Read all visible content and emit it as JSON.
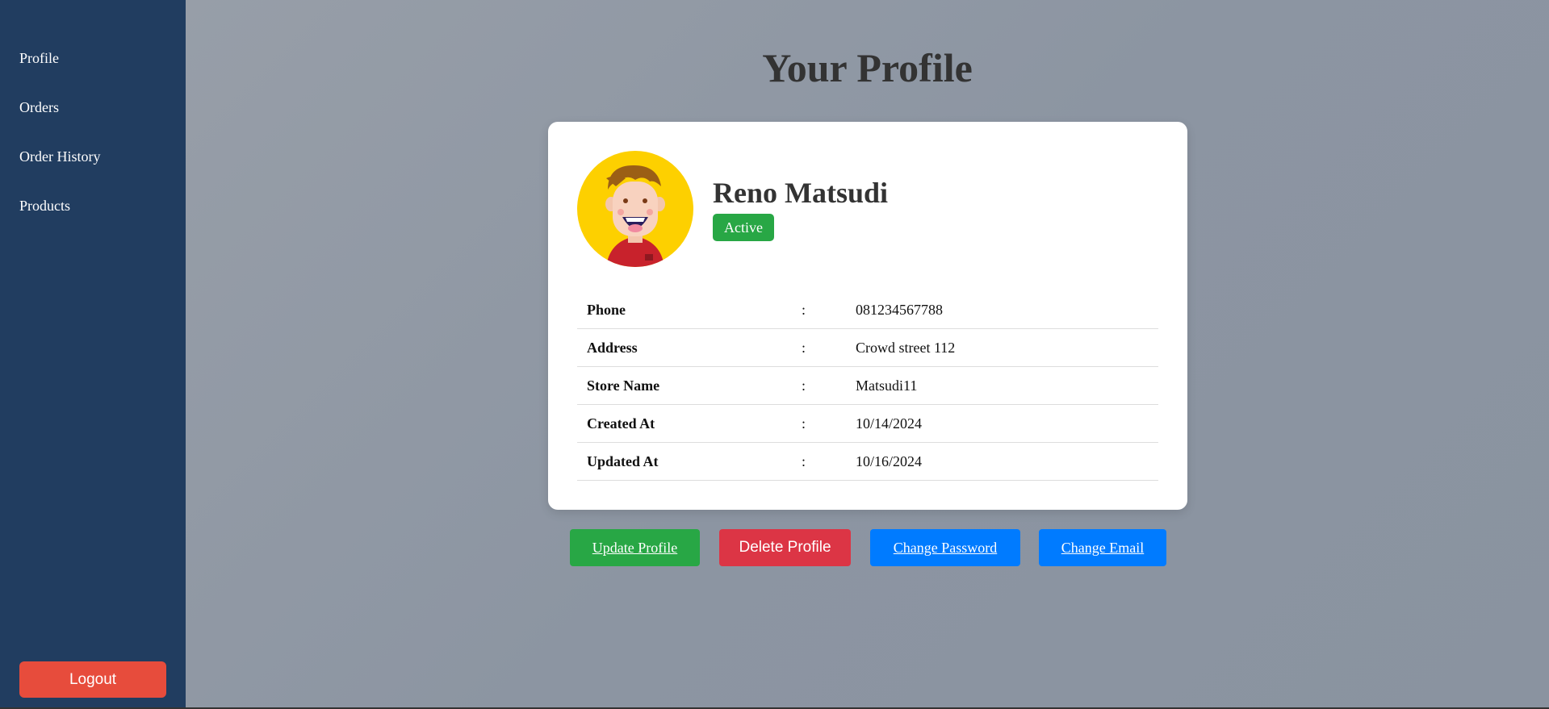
{
  "sidebar": {
    "items": [
      {
        "label": "Profile"
      },
      {
        "label": "Orders"
      },
      {
        "label": "Order History"
      },
      {
        "label": "Products"
      }
    ],
    "logout_label": "Logout"
  },
  "main": {
    "title": "Your Profile"
  },
  "profile": {
    "name": "Reno Matsudi",
    "status": "Active",
    "status_color": "#28a745",
    "avatar_bg": "#fdd000",
    "fields": [
      {
        "label": "Phone",
        "sep": ":",
        "value": "081234567788"
      },
      {
        "label": "Address",
        "sep": ":",
        "value": "Crowd street 112"
      },
      {
        "label": "Store Name",
        "sep": ":",
        "value": "Matsudi11"
      },
      {
        "label": "Created At",
        "sep": ":",
        "value": "10/14/2024"
      },
      {
        "label": "Updated At",
        "sep": ":",
        "value": "10/16/2024"
      }
    ]
  },
  "actions": {
    "update_label": "Update Profile",
    "delete_label": "Delete Profile",
    "password_label": "Change Password",
    "email_label": "Change Email"
  },
  "colors": {
    "sidebar_bg": "#213d60",
    "logout_bg": "#e74c3c",
    "success": "#28a745",
    "danger": "#dc3545",
    "primary": "#007bff"
  }
}
